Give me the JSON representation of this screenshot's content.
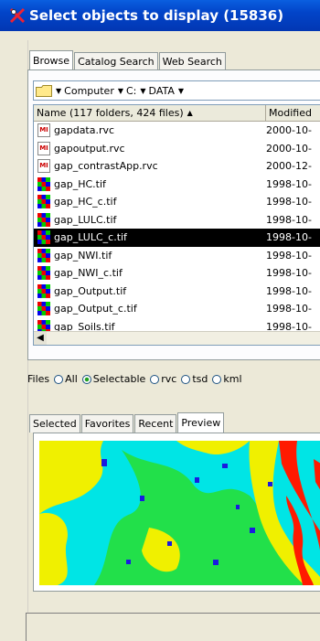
{
  "window": {
    "title": "Select objects to display (15836)"
  },
  "top_tabs": [
    "Browse",
    "Catalog Search",
    "Web Search"
  ],
  "path": [
    "Computer",
    "C:",
    "DATA"
  ],
  "columns": {
    "name": "Name (117 folders, 424 files)",
    "modified": "Modified"
  },
  "files": [
    {
      "name": "gapdata.rvc",
      "date": "2000-10-",
      "type": "rvc"
    },
    {
      "name": "gapoutput.rvc",
      "date": "2000-10-",
      "type": "rvc"
    },
    {
      "name": "gap_contrastApp.rvc",
      "date": "2000-12-",
      "type": "rvc"
    },
    {
      "name": "gap_HC.tif",
      "date": "1998-10-",
      "type": "tif"
    },
    {
      "name": "gap_HC_c.tif",
      "date": "1998-10-",
      "type": "tif"
    },
    {
      "name": "gap_LULC.tif",
      "date": "1998-10-",
      "type": "tif"
    },
    {
      "name": "gap_LULC_c.tif",
      "date": "1998-10-",
      "type": "tif",
      "selected": true
    },
    {
      "name": "gap_NWI.tif",
      "date": "1998-10-",
      "type": "tif"
    },
    {
      "name": "gap_NWI_c.tif",
      "date": "1998-10-",
      "type": "tif"
    },
    {
      "name": "gap_Output.tif",
      "date": "1998-10-",
      "type": "tif"
    },
    {
      "name": "gap_Output_c.tif",
      "date": "1998-10-",
      "type": "tif"
    },
    {
      "name": "gap_Soils.tif",
      "date": "1998-10-",
      "type": "tif"
    }
  ],
  "file_filter": {
    "label": "Files",
    "options": [
      {
        "label": "All",
        "checked": false
      },
      {
        "label": "Selectable",
        "checked": true
      },
      {
        "label": "rvc",
        "checked": false
      },
      {
        "label": "tsd",
        "checked": false
      },
      {
        "label": "kml",
        "checked": false
      }
    ]
  },
  "bottom_tabs": [
    "Selected",
    "Favorites",
    "Recent",
    "Preview"
  ],
  "active_bottom_tab": "Preview",
  "colors": {
    "title_bar": "#0244c8",
    "map_yellow": "#f0f000",
    "map_cyan": "#00e5e5",
    "map_green": "#22e04a",
    "map_blue": "#1a1ae0",
    "map_red": "#ff1a00"
  }
}
